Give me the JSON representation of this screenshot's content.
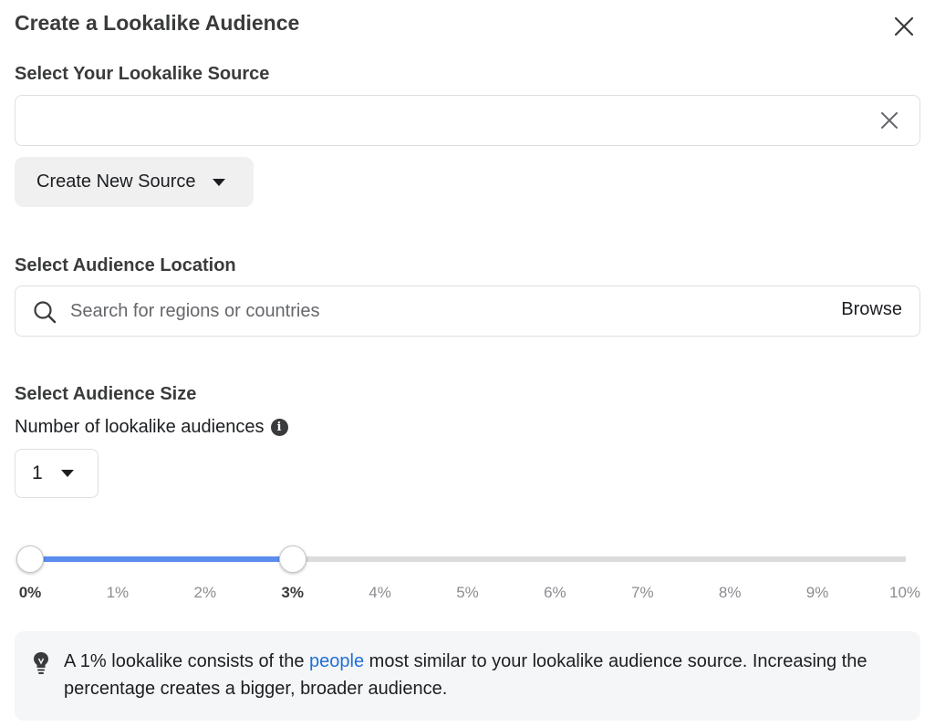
{
  "dialog": {
    "title": "Create a Lookalike Audience",
    "close_icon": "close-icon"
  },
  "source": {
    "label": "Select Your Lookalike Source",
    "value": "",
    "clear_icon": "close-icon",
    "create_button_label": "Create New Source",
    "create_button_icon": "caret-down-icon"
  },
  "location": {
    "label": "Select Audience Location",
    "placeholder": "Search for regions or countries",
    "value": "",
    "search_icon": "search-icon",
    "browse_label": "Browse"
  },
  "size": {
    "label": "Select Audience Size",
    "count_label": "Number of lookalike audiences",
    "info_icon": "info-icon",
    "count_value": "1",
    "slider": {
      "min_percent": 0,
      "max_percent": 10,
      "range_start_percent": 0,
      "range_end_percent": 3,
      "fill_color": "#5b8def",
      "track_color": "#dcdcdc",
      "ticks": [
        "0%",
        "1%",
        "2%",
        "3%",
        "4%",
        "5%",
        "6%",
        "7%",
        "8%",
        "9%",
        "10%"
      ],
      "active_ticks": [
        "0%",
        "3%"
      ]
    }
  },
  "tip": {
    "icon": "lightbulb-icon",
    "text_before": "A 1% lookalike consists of the ",
    "link_text": "people",
    "text_after": " most similar to your lookalike audience source. Increasing the percentage creates a bigger, broader audience.",
    "link_color": "#216fdb"
  }
}
